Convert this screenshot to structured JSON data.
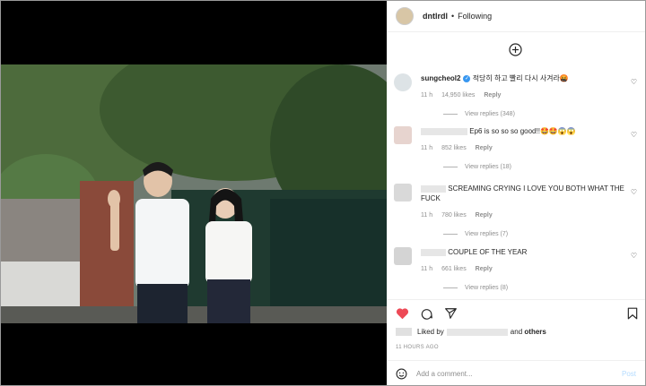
{
  "post": {
    "username": "dntlrdl",
    "dot": "•",
    "follow_label": "Following"
  },
  "comments": [
    {
      "user": "sungcheol2",
      "text": "적당히 하고 빨리 다시 사겨라🤬",
      "time": "11 h",
      "likes": "14,950 likes",
      "reply": "Reply",
      "view_replies": "View replies (348)"
    },
    {
      "user": "",
      "text": "Ep6 is so so so good!!🤩🤩😱😱",
      "time": "11 h",
      "likes": "852 likes",
      "reply": "Reply",
      "view_replies": "View replies (18)"
    },
    {
      "user": "",
      "text": "SCREAMING CRYING I LOVE YOU BOTH WHAT THE FUCK",
      "time": "11 h",
      "likes": "780 likes",
      "reply": "Reply",
      "view_replies": "View replies (7)"
    },
    {
      "user": "",
      "text": "COUPLE OF THE YEAR",
      "time": "11 h",
      "likes": "661 likes",
      "reply": "Reply",
      "view_replies": "View replies (8)"
    }
  ],
  "likes_summary": {
    "liked_by": "Liked by",
    "and": "and",
    "others": "others"
  },
  "timestamp": "11 HOURS AGO",
  "add_comment": {
    "placeholder": "Add a comment...",
    "post_label": "Post"
  },
  "colors": {
    "like_red": "#ed4956",
    "verified_blue": "#3897f0",
    "post_disabled": "#b3dbff"
  }
}
